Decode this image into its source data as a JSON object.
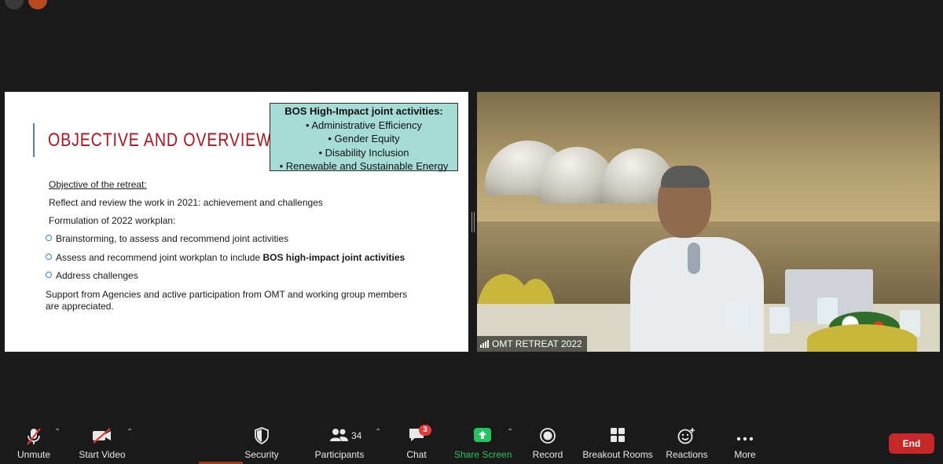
{
  "slide": {
    "title": "OBJECTIVE AND OVERVIEW",
    "bos_box": {
      "title": "BOS High-Impact joint activities:",
      "items": [
        "Administrative Efficiency",
        "Gender Equity",
        "Disability Inclusion",
        "Renewable and Sustainable Energy"
      ]
    },
    "objective_heading": "Objective of the retreat:",
    "reflect_line": "Reflect and review the work in 2021: achievement and challenges",
    "formulation_line": "Formulation of 2022 workplan:",
    "bullets": [
      {
        "text": "Brainstorming, to assess and recommend joint activities"
      },
      {
        "text": "Assess and recommend joint workplan to include ",
        "bold": "BOS high-impact joint activities"
      },
      {
        "text": "Address challenges"
      }
    ],
    "support_line_1": "Support from Agencies and active participation from OMT and working group members",
    "support_line_2": "are appreciated."
  },
  "video": {
    "participant_name": "OMT RETREAT 2022",
    "signal_icon": "signal-bars-icon"
  },
  "toolbar": {
    "unmute": "Unmute",
    "start_video": "Start Video",
    "security": "Security",
    "participants": "Participants",
    "participants_count": "34",
    "chat": "Chat",
    "chat_badge": "3",
    "share_screen": "Share Screen",
    "record": "Record",
    "breakout_rooms": "Breakout Rooms",
    "reactions": "Reactions",
    "more": "More",
    "end": "End"
  },
  "colors": {
    "share_green": "#22c55e",
    "end_red": "#c62828",
    "title_red": "#b4121d",
    "bos_box_teal": "#a6dcd6"
  }
}
